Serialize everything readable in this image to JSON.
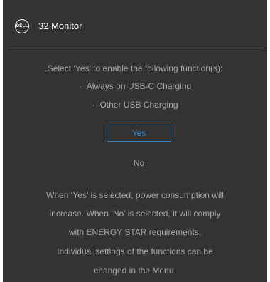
{
  "header": {
    "logo_text": "DELL",
    "title": "32 Monitor"
  },
  "prompt": {
    "question": "Select ‘Yes’ to enable the following function(s):",
    "functions": [
      "Always on USB-C Charging",
      "Other USB Charging"
    ]
  },
  "options": {
    "yes_label": "Yes",
    "no_label": "No",
    "selected": "Yes"
  },
  "notice": {
    "lines": [
      "When ‘Yes’ is selected, power consumption will",
      "increase. When ‘No’ is selected, it will comply",
      "with ENERGY STAR requirements.",
      "Individual settings of the functions can be",
      "changed in the Menu."
    ]
  },
  "colors": {
    "background": "#333333",
    "text": "#a6a6a6",
    "title": "#ffffff",
    "accent": "#2f86c9",
    "divider": "#8f8f8f"
  },
  "icons": {
    "logo": "dell-logo-icon"
  }
}
